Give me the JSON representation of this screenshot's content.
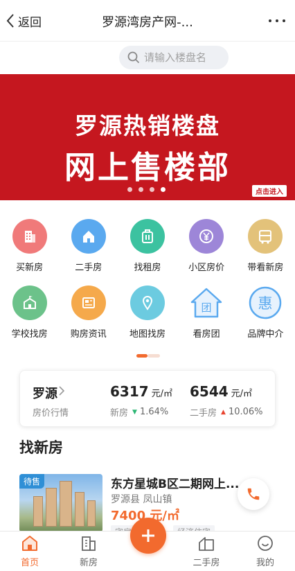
{
  "nav": {
    "back_label": "返回",
    "title": "罗源湾房产网-..."
  },
  "search": {
    "placeholder": "请输入楼盘名"
  },
  "banner": {
    "line1": "罗源热销楼盘",
    "line2": "网上售楼部",
    "enter_label": "点击进入",
    "slides": 4,
    "active_slide": 4,
    "background": "#c5171f"
  },
  "grid": {
    "items": [
      {
        "label": "买新房",
        "icon": "building-icon",
        "color": "#f07a7a"
      },
      {
        "label": "二手房",
        "icon": "house-icon",
        "color": "#5aa9ef"
      },
      {
        "label": "找租房",
        "icon": "suitcase-icon",
        "color": "#3cc2a0"
      },
      {
        "label": "小区房价",
        "icon": "yen-coin-icon",
        "color": "#9d86d8"
      },
      {
        "label": "带看新房",
        "icon": "bus-icon",
        "color": "#e3c27a"
      },
      {
        "label": "学校找房",
        "icon": "school-icon",
        "color": "#6cc28a"
      },
      {
        "label": "购房资讯",
        "icon": "news-icon",
        "color": "#f5a94b"
      },
      {
        "label": "地图找房",
        "icon": "map-pin-icon",
        "color": "#6ccbe0"
      },
      {
        "label": "看房团",
        "icon": "group-house-icon",
        "color": "#5aa9ef"
      },
      {
        "label": "品牌中介",
        "icon": "hui-badge-icon",
        "color": "#5aa9ef"
      }
    ]
  },
  "price_summary": {
    "city": "罗源",
    "subtitle": "房价行情",
    "new_house": {
      "value": "6317",
      "unit": "元/㎡",
      "label": "新房",
      "change": "1.64%",
      "trend": "down"
    },
    "second_hand": {
      "value": "6544",
      "unit": "元/㎡",
      "label": "二手房",
      "change": "10.06%",
      "trend": "up"
    }
  },
  "section": {
    "title": "找新房"
  },
  "listing": {
    "badge": "待售",
    "name": "东方星城B区二期网上...",
    "location": "罗源县  凤山镇",
    "price": "7400 元/㎡",
    "tags": [
      "宅房",
      "经济住宅"
    ]
  },
  "bottom_nav": {
    "tabs": [
      {
        "label": "首页",
        "icon": "home-icon",
        "active": true
      },
      {
        "label": "新房",
        "icon": "building-icon",
        "active": false
      },
      {
        "label": "二手房",
        "icon": "house-icon",
        "active": false
      },
      {
        "label": "我的",
        "icon": "smile-icon",
        "active": false
      }
    ]
  },
  "colors": {
    "accent": "#f26a2e",
    "down": "#2bb673",
    "up": "#e8432f"
  }
}
